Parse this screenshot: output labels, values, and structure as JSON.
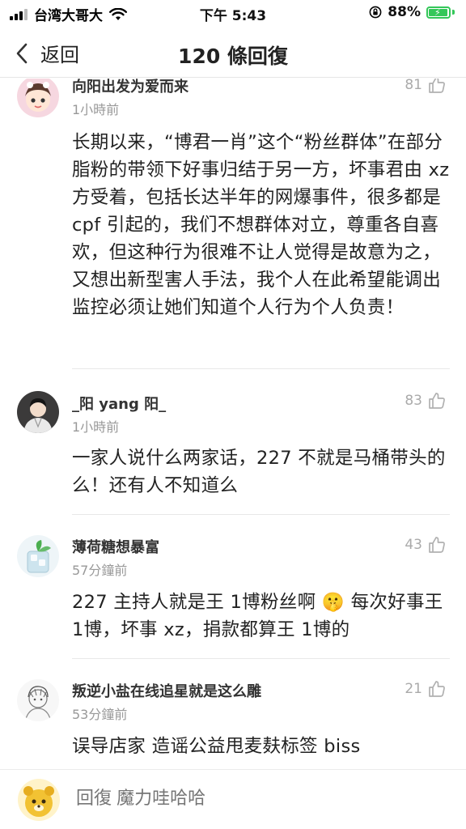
{
  "status_bar": {
    "carrier": "台湾大哥大",
    "time": "下午 5:43",
    "battery": "88%"
  },
  "nav": {
    "back_label": "返回",
    "title": "120 條回復"
  },
  "comments": [
    {
      "username": "向阳出发为爱而来",
      "time": "1小時前",
      "likes": "81",
      "text": "长期以来，“博君一肖”这个“粉丝群体”在部分脂粉的带领下好事归结于另一方，坏事君由 xz 方受着，包括长达半年的网爆事件，很多都是 cpf 引起的，我们不想群体对立，尊重各自喜欢，但这种行为很难不让人觉得是故意为之，又想出新型害人手法，我个人在此希望能调出监控必须让她们知道个人行为个人负责！"
    },
    {
      "username": "_阳 yang 阳_",
      "time": "1小時前",
      "likes": "83",
      "text": "一家人说什么两家话，227 不就是马桶带头的么！还有人不知道么"
    },
    {
      "username": "薄荷糖想暴富",
      "time": "57分鐘前",
      "likes": "43",
      "text": "227 主持人就是王 1博粉丝啊 🤫 每次好事王 1博，坏事 xz，捐款都算王 1博的"
    },
    {
      "username": "叛逆小盐在线追星就是这么雕",
      "time": "53分鐘前",
      "likes": "21",
      "text": "误导店家  造谣公益甩麦麸标签 biss"
    }
  ],
  "reply": {
    "placeholder": "回復 魔力哇哈哈"
  }
}
